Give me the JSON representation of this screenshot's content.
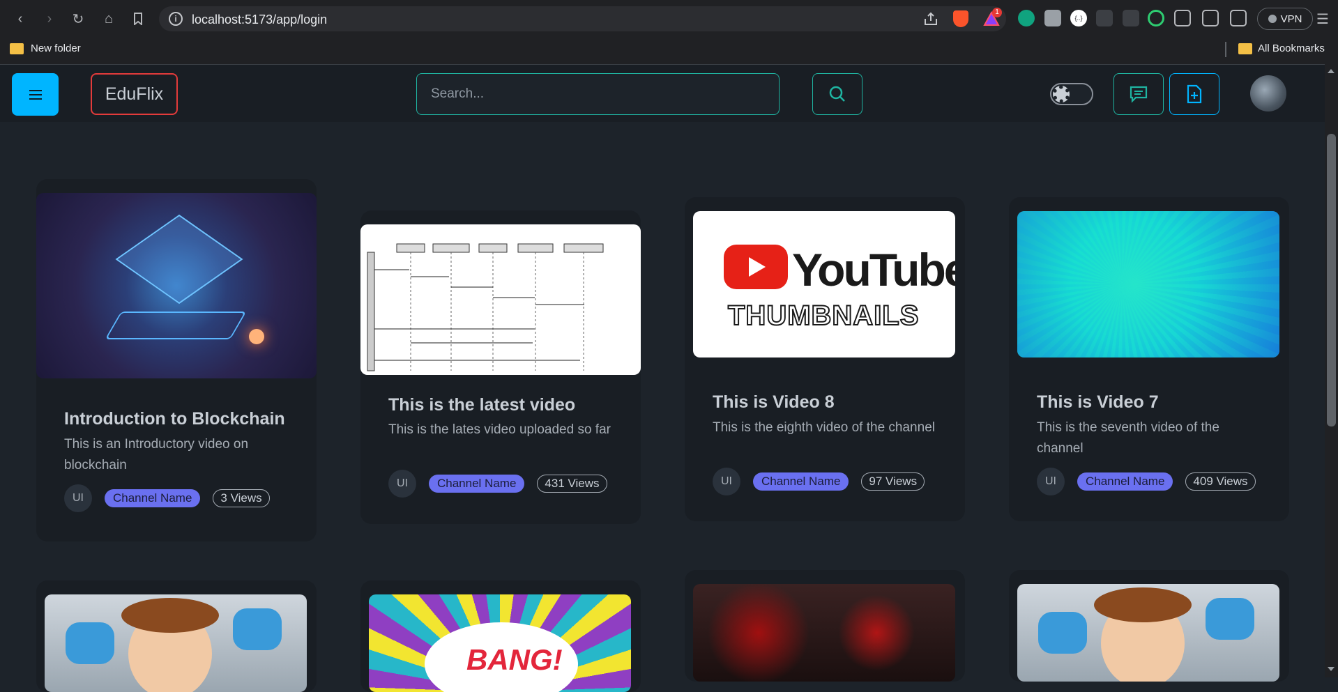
{
  "browser": {
    "url": "localhost:5173/app/login",
    "vpn_label": "VPN",
    "notification_count": "1",
    "bookmarks": [
      {
        "label": "New folder"
      },
      {
        "label": "All Bookmarks"
      }
    ]
  },
  "header": {
    "logo": "EduFlix",
    "search_placeholder": "Search..."
  },
  "cards": [
    {
      "title": "Introduction to Blockchain",
      "description": "This is an Introductory video on blockchain",
      "avatar": "UI",
      "channel": "Channel Name",
      "views": "3 Views",
      "thumbnail": "blockchain-illustration"
    },
    {
      "title": "This is the latest video",
      "description": "This is the lates video uploaded so far",
      "avatar": "UI",
      "channel": "Channel Name",
      "views": "431 Views",
      "thumbnail": "sequence-diagram"
    },
    {
      "title": "This is Video 8",
      "description": "This is the eighth video of the channel",
      "avatar": "UI",
      "channel": "Channel Name",
      "views": "97 Views",
      "thumbnail": "youtube-thumbnails"
    },
    {
      "title": "This is Video 7",
      "description": "This is the seventh video of the channel",
      "avatar": "UI",
      "channel": "Channel Name",
      "views": "409 Views",
      "thumbnail": "teal-burst"
    }
  ],
  "yt_thumb": {
    "line1": "YouTube",
    "line2": "THUMBNAILS"
  },
  "bang_text": "BANG!",
  "colors": {
    "accent": "#00b5ff",
    "border_teal": "#1fb5a2",
    "logo_border": "#e33b3b",
    "channel_badge": "#6a70f0"
  }
}
